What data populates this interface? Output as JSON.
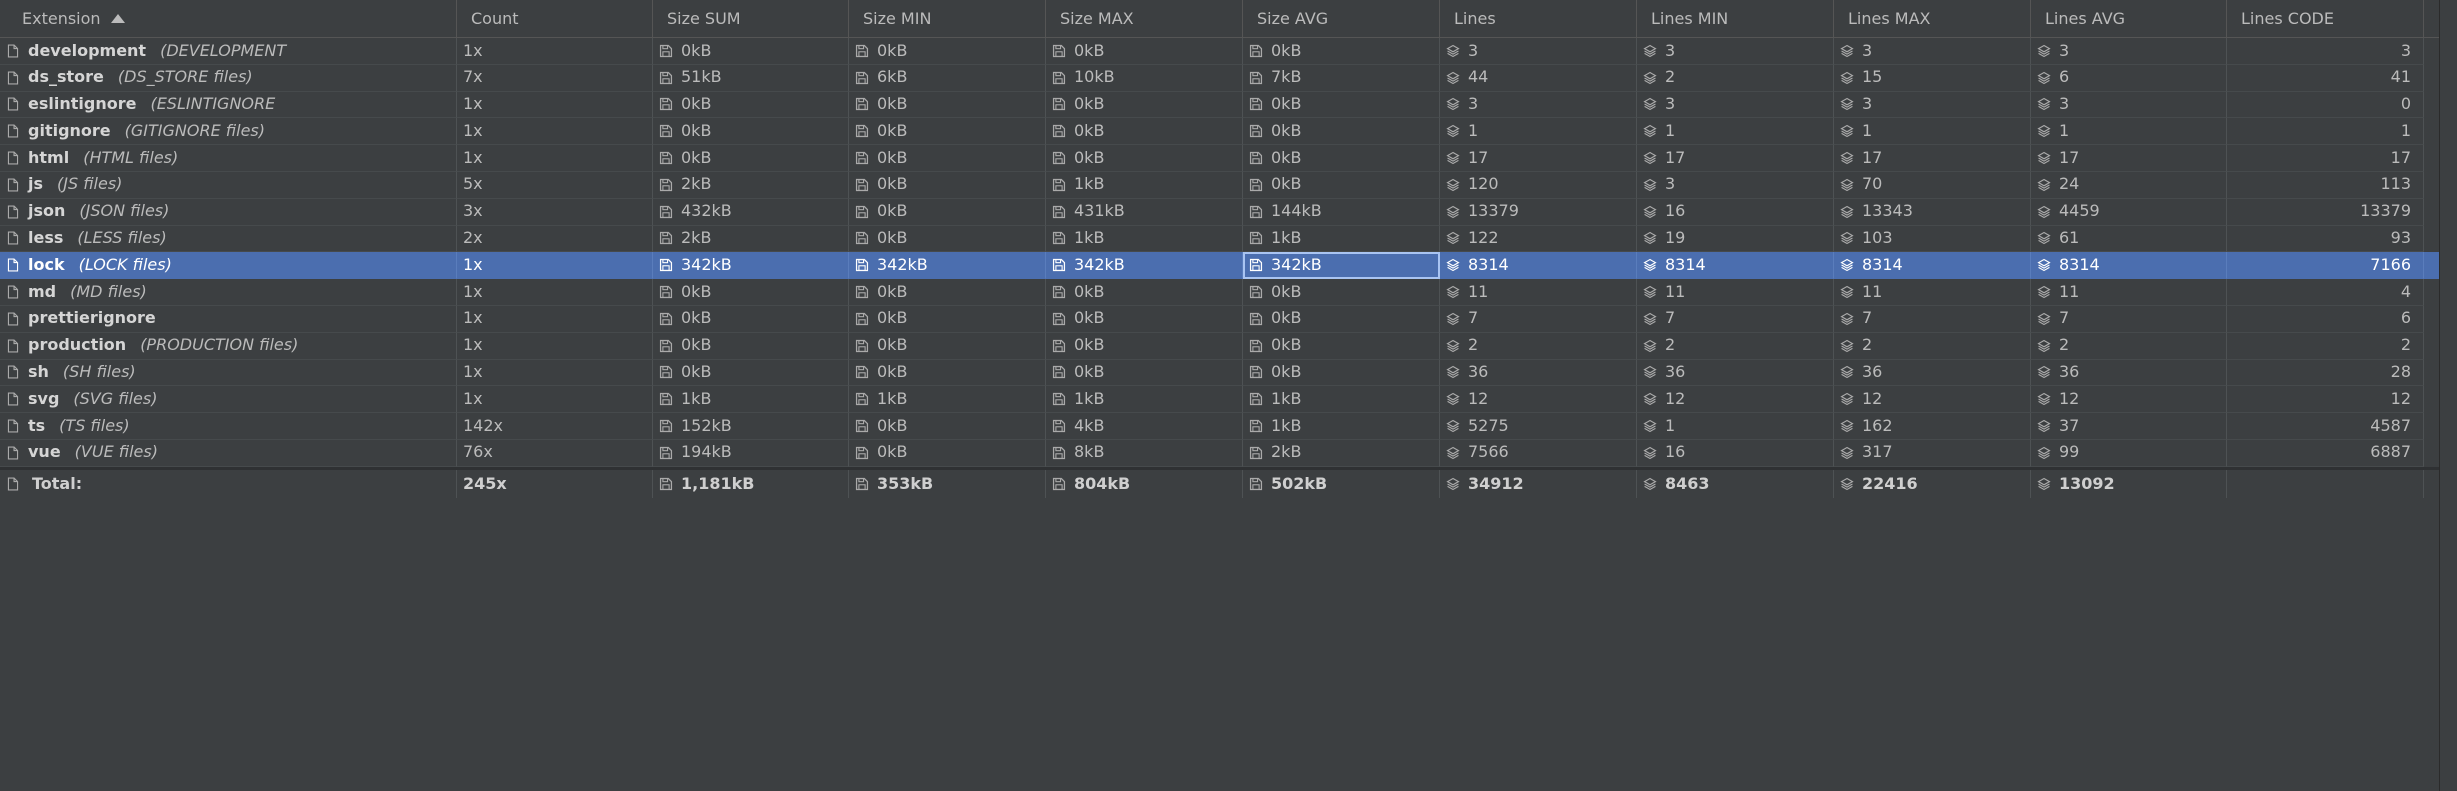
{
  "header": {
    "columns": [
      "Extension",
      "Count",
      "Size SUM",
      "Size MIN",
      "Size MAX",
      "Size AVG",
      "Lines",
      "Lines MIN",
      "Lines MAX",
      "Lines AVG",
      "Lines CODE"
    ]
  },
  "rows": [
    {
      "ext": "development",
      "desc": "(DEVELOPMENT",
      "count": "1x",
      "size_sum": "0kB",
      "size_min": "0kB",
      "size_max": "0kB",
      "size_avg": "0kB",
      "lines": "3",
      "lines_min": "3",
      "lines_max": "3",
      "lines_avg": "3",
      "lines_code": "3"
    },
    {
      "ext": "ds_store",
      "desc": "(DS_STORE files)",
      "count": "7x",
      "size_sum": "51kB",
      "size_min": "6kB",
      "size_max": "10kB",
      "size_avg": "7kB",
      "lines": "44",
      "lines_min": "2",
      "lines_max": "15",
      "lines_avg": "6",
      "lines_code": "41"
    },
    {
      "ext": "eslintignore",
      "desc": "(ESLINTIGNORE",
      "count": "1x",
      "size_sum": "0kB",
      "size_min": "0kB",
      "size_max": "0kB",
      "size_avg": "0kB",
      "lines": "3",
      "lines_min": "3",
      "lines_max": "3",
      "lines_avg": "3",
      "lines_code": "0"
    },
    {
      "ext": "gitignore",
      "desc": "(GITIGNORE files)",
      "count": "1x",
      "size_sum": "0kB",
      "size_min": "0kB",
      "size_max": "0kB",
      "size_avg": "0kB",
      "lines": "1",
      "lines_min": "1",
      "lines_max": "1",
      "lines_avg": "1",
      "lines_code": "1"
    },
    {
      "ext": "html",
      "desc": "(HTML files)",
      "count": "1x",
      "size_sum": "0kB",
      "size_min": "0kB",
      "size_max": "0kB",
      "size_avg": "0kB",
      "lines": "17",
      "lines_min": "17",
      "lines_max": "17",
      "lines_avg": "17",
      "lines_code": "17"
    },
    {
      "ext": "js",
      "desc": "(JS files)",
      "count": "5x",
      "size_sum": "2kB",
      "size_min": "0kB",
      "size_max": "1kB",
      "size_avg": "0kB",
      "lines": "120",
      "lines_min": "3",
      "lines_max": "70",
      "lines_avg": "24",
      "lines_code": "113"
    },
    {
      "ext": "json",
      "desc": "(JSON files)",
      "count": "3x",
      "size_sum": "432kB",
      "size_min": "0kB",
      "size_max": "431kB",
      "size_avg": "144kB",
      "lines": "13379",
      "lines_min": "16",
      "lines_max": "13343",
      "lines_avg": "4459",
      "lines_code": "13379"
    },
    {
      "ext": "less",
      "desc": "(LESS files)",
      "count": "2x",
      "size_sum": "2kB",
      "size_min": "0kB",
      "size_max": "1kB",
      "size_avg": "1kB",
      "lines": "122",
      "lines_min": "19",
      "lines_max": "103",
      "lines_avg": "61",
      "lines_code": "93"
    },
    {
      "ext": "lock",
      "desc": "(LOCK files)",
      "count": "1x",
      "size_sum": "342kB",
      "size_min": "342kB",
      "size_max": "342kB",
      "size_avg": "342kB",
      "lines": "8314",
      "lines_min": "8314",
      "lines_max": "8314",
      "lines_avg": "8314",
      "lines_code": "7166",
      "selected": true
    },
    {
      "ext": "md",
      "desc": "(MD files)",
      "count": "1x",
      "size_sum": "0kB",
      "size_min": "0kB",
      "size_max": "0kB",
      "size_avg": "0kB",
      "lines": "11",
      "lines_min": "11",
      "lines_max": "11",
      "lines_avg": "11",
      "lines_code": "4"
    },
    {
      "ext": "prettierignore",
      "desc": "",
      "count": "1x",
      "size_sum": "0kB",
      "size_min": "0kB",
      "size_max": "0kB",
      "size_avg": "0kB",
      "lines": "7",
      "lines_min": "7",
      "lines_max": "7",
      "lines_avg": "7",
      "lines_code": "6"
    },
    {
      "ext": "production",
      "desc": "(PRODUCTION files)",
      "count": "1x",
      "size_sum": "0kB",
      "size_min": "0kB",
      "size_max": "0kB",
      "size_avg": "0kB",
      "lines": "2",
      "lines_min": "2",
      "lines_max": "2",
      "lines_avg": "2",
      "lines_code": "2"
    },
    {
      "ext": "sh",
      "desc": "(SH files)",
      "count": "1x",
      "size_sum": "0kB",
      "size_min": "0kB",
      "size_max": "0kB",
      "size_avg": "0kB",
      "lines": "36",
      "lines_min": "36",
      "lines_max": "36",
      "lines_avg": "36",
      "lines_code": "28"
    },
    {
      "ext": "svg",
      "desc": "(SVG files)",
      "count": "1x",
      "size_sum": "1kB",
      "size_min": "1kB",
      "size_max": "1kB",
      "size_avg": "1kB",
      "lines": "12",
      "lines_min": "12",
      "lines_max": "12",
      "lines_avg": "12",
      "lines_code": "12"
    },
    {
      "ext": "ts",
      "desc": "(TS files)",
      "count": "142x",
      "size_sum": "152kB",
      "size_min": "0kB",
      "size_max": "4kB",
      "size_avg": "1kB",
      "lines": "5275",
      "lines_min": "1",
      "lines_max": "162",
      "lines_avg": "37",
      "lines_code": "4587"
    },
    {
      "ext": "vue",
      "desc": "(VUE files)",
      "count": "76x",
      "size_sum": "194kB",
      "size_min": "0kB",
      "size_max": "8kB",
      "size_avg": "2kB",
      "lines": "7566",
      "lines_min": "16",
      "lines_max": "317",
      "lines_avg": "99",
      "lines_code": "6887"
    }
  ],
  "total": {
    "label": "Total:",
    "count": "245x",
    "size_sum": "1,181kB",
    "size_min": "353kB",
    "size_max": "804kB",
    "size_avg": "502kB",
    "lines": "34912",
    "lines_min": "8463",
    "lines_max": "22416",
    "lines_avg": "13092",
    "lines_code": ""
  },
  "icons": {
    "file": "file-icon",
    "size": "floppy-disk-icon",
    "lines": "layers-icon",
    "sort": "sort-ascending-icon"
  },
  "colors": {
    "background": "#3c3f41",
    "selection": "#4b6eaf",
    "text": "#bbbbbb"
  }
}
